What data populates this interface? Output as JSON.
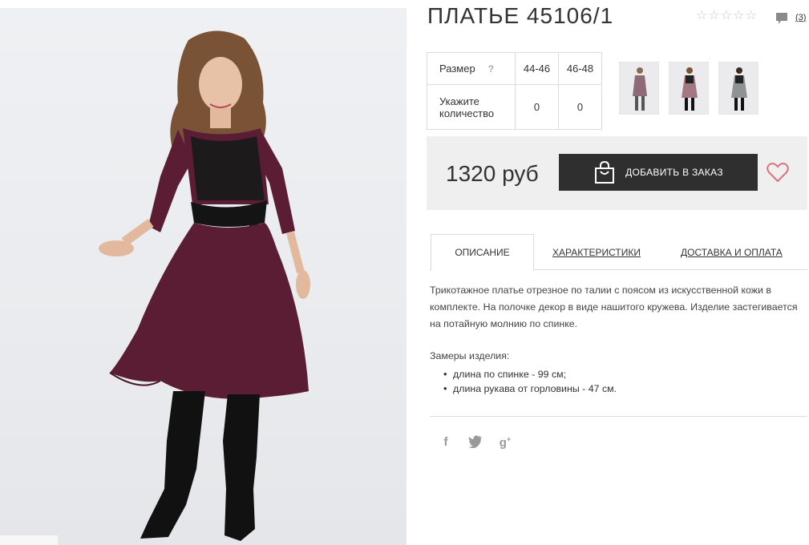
{
  "product": {
    "title": "ПЛАТЬЕ 45106/1",
    "rating_stars": 5,
    "rating_filled": 0,
    "comments_count": "(3)"
  },
  "size_table": {
    "size_label": "Размер",
    "help": "?",
    "sizes": [
      "44-46",
      "46-48"
    ],
    "qty_label_line1": "Укажите",
    "qty_label_line2": "количество",
    "quantities": [
      "0",
      "0"
    ]
  },
  "purchase": {
    "price": "1320 руб",
    "add_button": "ДОБАВИТЬ В ЗАКАЗ"
  },
  "tabs": [
    {
      "label": "ОПИСАНИЕ",
      "active": true
    },
    {
      "label": "ХАРАКТЕРИСТИКИ",
      "active": false
    },
    {
      "label": "ДОСТАВКА И ОПЛАТА",
      "active": false
    }
  ],
  "description": {
    "text": "Трикотажное платье отрезное по талии с поясом из искусственной кожи в комплекте. На полочке декор в виде нашитого кружева. Изделие застегивается на потайную молнию по спинке.",
    "measures_title": "Замеры изделия:",
    "measures": [
      "длина по спинке - 99 см;",
      "длина рукава от горловины - 47 см."
    ]
  },
  "social": [
    "f",
    "twitter",
    "g+"
  ],
  "colors": {
    "dress": "#5a1d33",
    "button_bg": "#2f2f2f",
    "heart": "#d9737f",
    "price_bar_bg": "#efefef"
  }
}
